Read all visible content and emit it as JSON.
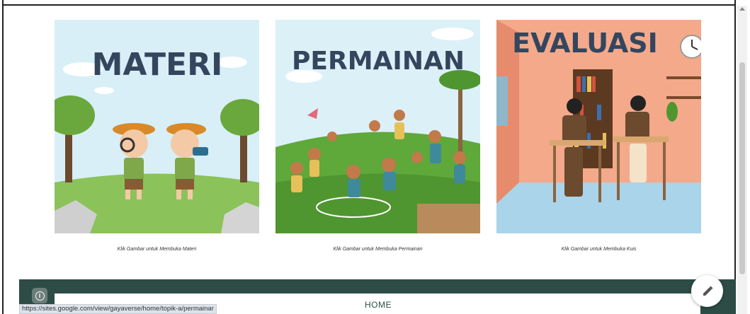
{
  "cards": [
    {
      "title": "MATERI",
      "caption": "Klik Gambar untuk Membuka Materi"
    },
    {
      "title": "PERMAINAN",
      "caption": "Klik Gambar untuk Membuka Permainan"
    },
    {
      "title": "EVALUASI",
      "caption": "Klik Gambar untuk Membuka Kuis"
    }
  ],
  "footer": {
    "nav_home": "HOME",
    "info_icon": "info-icon",
    "edit_icon": "pencil-icon"
  },
  "status_bar": {
    "url": "https://sites.google.com/view/gayaverse/home/topik-a/permainar"
  },
  "colors": {
    "footer_bg": "#2c4c45",
    "title_text": "#34465e",
    "materi_sky": "#d6eef6",
    "permainan_grass": "#5fa83a",
    "evaluasi_wall": "#f4a98a"
  }
}
